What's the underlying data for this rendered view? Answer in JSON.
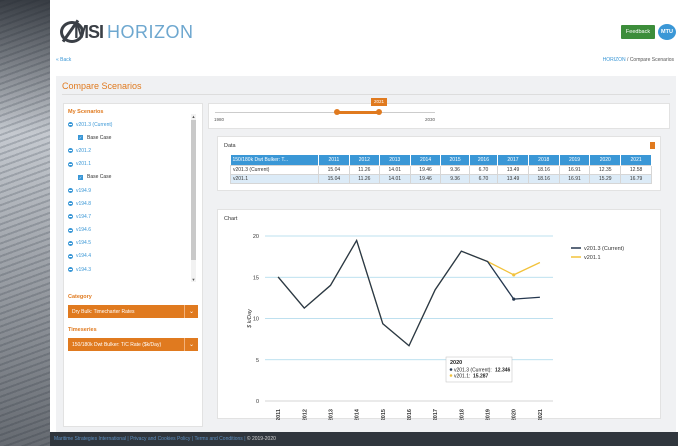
{
  "app": {
    "logo_main": "MSI",
    "logo_sub": "HORIZON",
    "feedback_label": "Feedback",
    "user_initials": "MTU"
  },
  "nav": {
    "back_label": "« Back",
    "breadcrumb_root": "HORIZON",
    "breadcrumb_sep": "/",
    "breadcrumb_current": "Compare Scenarios"
  },
  "page": {
    "title": "Compare Scenarios"
  },
  "sidebar": {
    "scenarios_heading": "My Scenarios",
    "scenarios": [
      {
        "label": "v201.3 (Current)",
        "sub": "Base Case"
      },
      {
        "label": "v201.2"
      },
      {
        "label": "v201.1",
        "sub": "Base Case"
      },
      {
        "label": "v194.9"
      },
      {
        "label": "v194.8"
      },
      {
        "label": "v194.7"
      },
      {
        "label": "v194.6"
      },
      {
        "label": "v194.5"
      },
      {
        "label": "v194.4"
      },
      {
        "label": "v194.3"
      }
    ],
    "category_heading": "Category",
    "category_value": "Dry Bulk: Timecharter Rates",
    "timeseries_heading": "Timeseries",
    "timeseries_value": "150/180k Dwt Bulker: T/C Rate ($k/Day)"
  },
  "timeline": {
    "min_label": "1980",
    "max_label": "2030",
    "selected_label": "2021",
    "range_start": 2011,
    "range_end": 2021
  },
  "data_panel": {
    "title": "Data",
    "columns": [
      "150/180k Dwt Bulker: T...",
      "2011",
      "2012",
      "2013",
      "2014",
      "2015",
      "2016",
      "2017",
      "2018",
      "2019",
      "2020",
      "2021"
    ],
    "rows": [
      [
        "v201.3 (Current)",
        "15.04",
        "11.26",
        "14.01",
        "19.46",
        "9.36",
        "6.70",
        "13.49",
        "18.16",
        "16.91",
        "12.35",
        "12.58"
      ],
      [
        "v201.1",
        "15.04",
        "11.26",
        "14.01",
        "19.46",
        "9.36",
        "6.70",
        "13.49",
        "18.16",
        "16.91",
        "15.29",
        "16.79"
      ]
    ]
  },
  "chart_panel": {
    "title": "Chart",
    "tooltip": {
      "year": "2020",
      "line1_label": "v201.3 (Current):",
      "line1_value": "12.346",
      "line2_label": "v201.1:",
      "line2_value": "15.287"
    }
  },
  "chart_data": {
    "type": "line",
    "x": [
      "2011",
      "2012",
      "2013",
      "2014",
      "2015",
      "2016",
      "2017",
      "2018",
      "2019",
      "2020",
      "2021"
    ],
    "series": [
      {
        "name": "v201.3 (Current)",
        "color": "#25374f",
        "values": [
          15.04,
          11.26,
          14.01,
          19.46,
          9.36,
          6.7,
          13.49,
          18.16,
          16.91,
          12.35,
          12.58
        ]
      },
      {
        "name": "v201.1",
        "color": "#f2c23b",
        "values": [
          15.04,
          11.26,
          14.01,
          19.46,
          9.36,
          6.7,
          13.49,
          18.16,
          16.91,
          15.29,
          16.79
        ]
      }
    ],
    "ylabel": "$ k/Day",
    "yticks": [
      0,
      5,
      10,
      15,
      20
    ],
    "ylim": [
      0,
      20
    ],
    "grid": true,
    "legend": "right"
  },
  "footer": {
    "links": [
      "Maritime Strategies International",
      "Privacy and Cookies Policy",
      "Terms and Conditions"
    ],
    "copyright": "© 2019-2020"
  }
}
